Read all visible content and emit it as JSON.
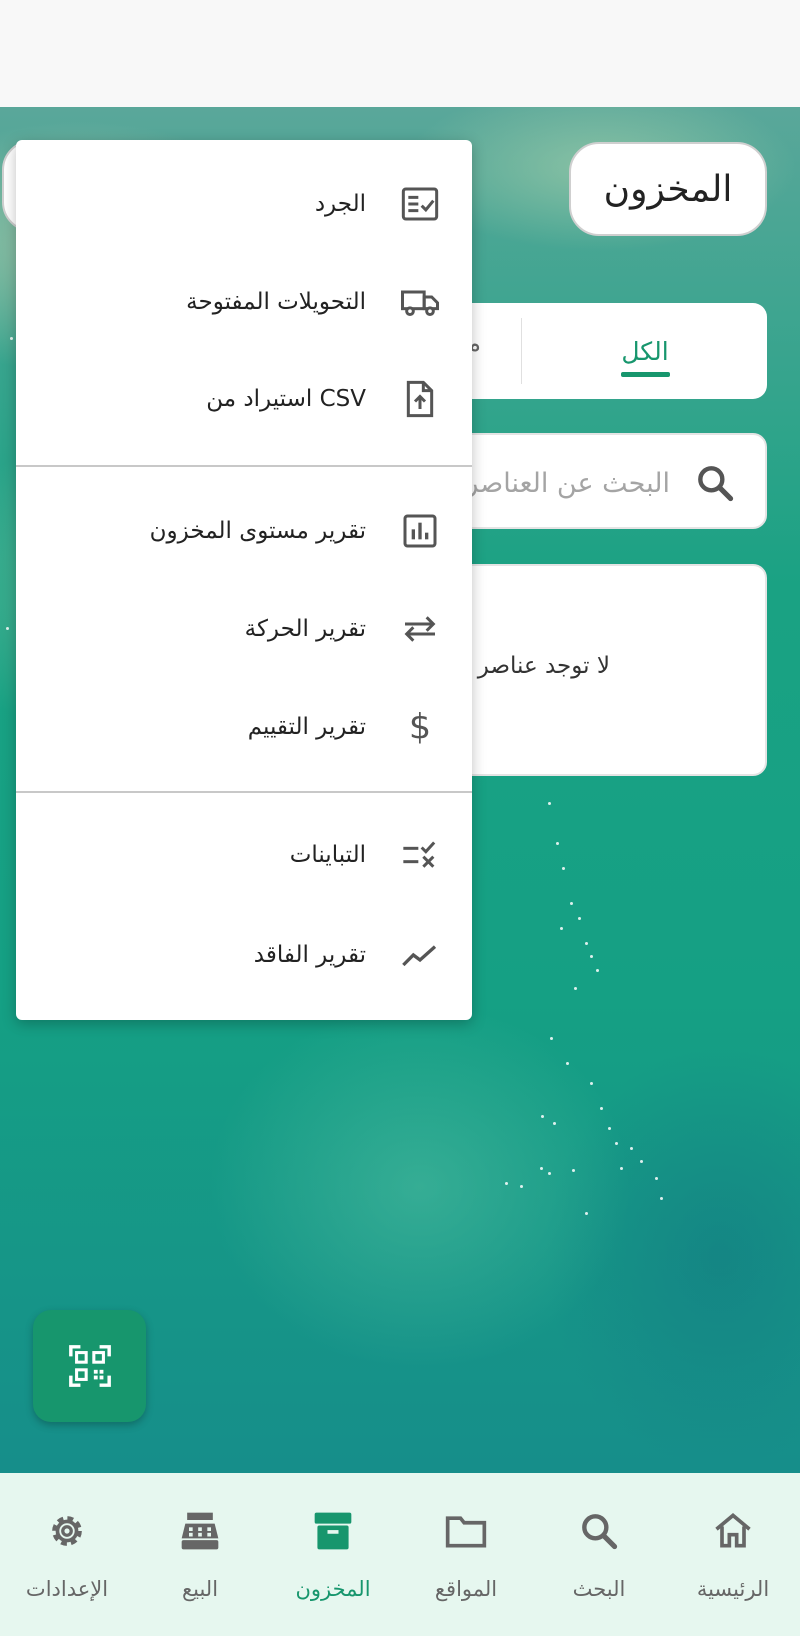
{
  "header": {
    "title": "المخزون"
  },
  "tabs": {
    "all_label": "الكل",
    "other_label_partial": "م"
  },
  "search": {
    "placeholder": "البحث عن العناصر"
  },
  "empty_state": {
    "text": "لا توجد عناصر"
  },
  "menu": {
    "items": [
      {
        "label": "الجرد",
        "icon": "checklist-icon"
      },
      {
        "label": "التحويلات المفتوحة",
        "icon": "truck-icon"
      },
      {
        "label": "استيراد من CSV",
        "icon": "file-upload-icon"
      },
      {
        "label": "تقرير مستوى المخزون",
        "icon": "bar-chart-icon"
      },
      {
        "label": "تقرير الحركة",
        "icon": "swap-arrows-icon"
      },
      {
        "label": "تقرير التقييم",
        "icon": "dollar-icon"
      },
      {
        "label": "التباينات",
        "icon": "rule-icon"
      },
      {
        "label": "تقرير الفاقد",
        "icon": "trending-down-icon"
      }
    ]
  },
  "fab": {
    "icon": "qr-scan-icon"
  },
  "bottom_nav": {
    "items": [
      {
        "label": "الرئيسية",
        "icon": "home-icon"
      },
      {
        "label": "البحث",
        "icon": "search-icon"
      },
      {
        "label": "المواقع",
        "icon": "folder-icon"
      },
      {
        "label": "المخزون",
        "icon": "archive-icon",
        "active": true
      },
      {
        "label": "البيع",
        "icon": "cash-register-icon"
      },
      {
        "label": "الإعدادات",
        "icon": "gear-icon"
      }
    ]
  },
  "colors": {
    "accent": "#17966d",
    "nav_bg": "#e6f7ef",
    "text": "#222222"
  }
}
